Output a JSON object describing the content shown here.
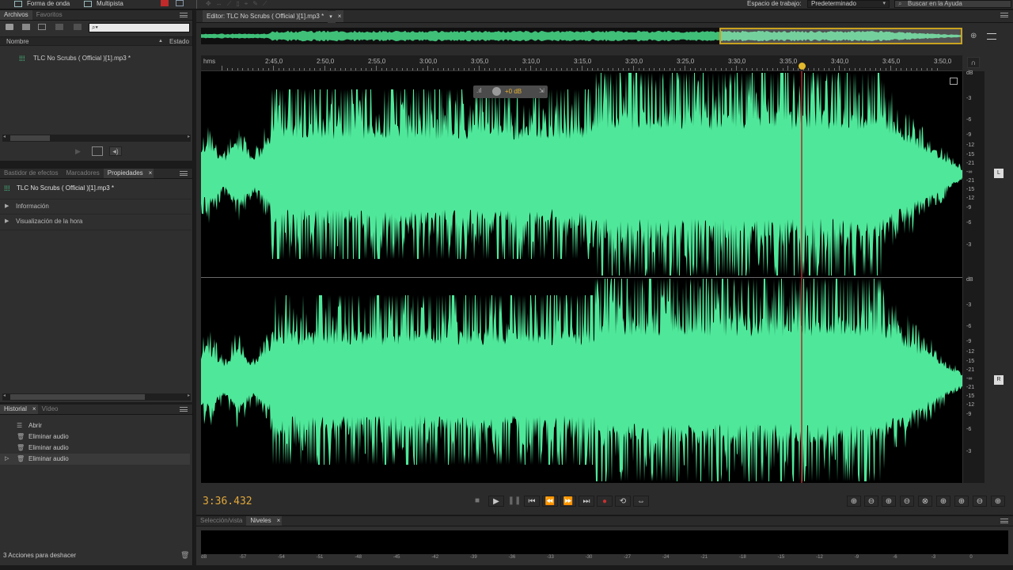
{
  "topbar": {
    "waveform_label": "Forma de onda",
    "multitrack_label": "Multipista",
    "workspace_label": "Espacio de trabajo:",
    "workspace_value": "Predeterminado",
    "help_placeholder": "Buscar en la Ayuda"
  },
  "files_panel": {
    "tabs": [
      "Archivos",
      "Favoritos"
    ],
    "col_name": "Nombre",
    "col_status": "Estado",
    "file_name": "TLC No Scrubs ( Official )[1].mp3 *"
  },
  "props_panel": {
    "tabs": [
      "Bastidor de efectos",
      "Marcadores",
      "Propiedades"
    ],
    "file_name": "TLC No Scrubs ( Official )[1].mp3 *",
    "sections": [
      "Información",
      "Visualización de la hora"
    ]
  },
  "history_panel": {
    "tabs": [
      "Historial",
      "Vídeo"
    ],
    "items": [
      "Abrir",
      "Eliminar audio",
      "Eliminar audio",
      "Eliminar audio"
    ],
    "footer": "3 Acciones para deshacer"
  },
  "editor": {
    "tab_label": "Editor: TLC No Scrubs ( Official )[1].mp3 *",
    "hms_label": "hms",
    "time_ticks": [
      "2:45,0",
      "2:50,0",
      "2:55,0",
      "3:00,0",
      "3:05,0",
      "3:10,0",
      "3:15,0",
      "3:20,0",
      "3:25,0",
      "3:30,0",
      "3:35,0",
      "3:40,0",
      "3:45,0",
      "3:50,0"
    ],
    "db_labels": [
      "dB",
      "-3",
      "-6",
      "-9",
      "-12",
      "-15",
      "-21",
      "-∞",
      "-21",
      "-15",
      "-12",
      "-9",
      "-6",
      "-3"
    ],
    "hud_db": "+0 dB",
    "current_time": "3:36.432",
    "channel_left": "L",
    "channel_right": "R",
    "waveform_color": "#4fe89a",
    "playhead_color": "#b0282a"
  },
  "levels_panel": {
    "tabs": [
      "Selección/vista",
      "Niveles"
    ],
    "scale": [
      "dB",
      "-57",
      "-54",
      "-51",
      "-48",
      "-45",
      "-42",
      "-39",
      "-36",
      "-33",
      "-30",
      "-27",
      "-24",
      "-21",
      "-18",
      "-15",
      "-12",
      "-9",
      "-6",
      "-3",
      "0"
    ]
  }
}
